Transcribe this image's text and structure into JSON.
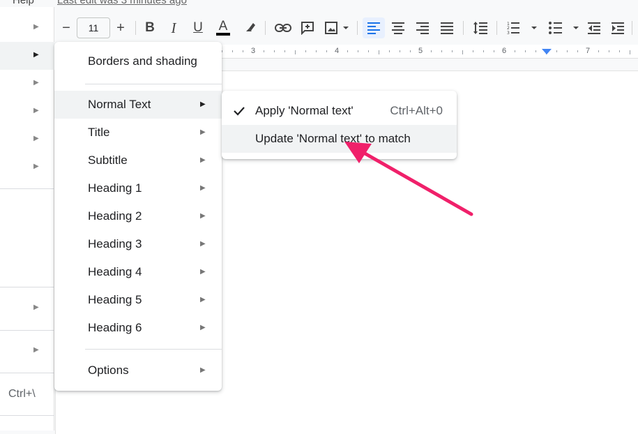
{
  "header": {
    "help_menu": "Help",
    "last_edit": "Last edit was 3 minutes ago"
  },
  "toolbar": {
    "font_size": "11",
    "decrease_size": "−",
    "increase_size": "+",
    "bold": "B",
    "italic": "I",
    "underline": "U",
    "text_color": "A",
    "icons": [
      "minus-icon",
      "plus-icon",
      "bold-icon",
      "italic-icon",
      "underline-icon",
      "text-color-icon",
      "highlight-icon",
      "link-icon",
      "add-comment-icon",
      "insert-image-icon",
      "align-left-icon",
      "align-center-icon",
      "align-right-icon",
      "justify-icon",
      "line-spacing-icon",
      "numbered-list-icon",
      "bulleted-list-icon",
      "decrease-indent-icon",
      "increase-indent-icon"
    ],
    "active_alignment": "align-left"
  },
  "ruler": {
    "numbers": [
      "3",
      "4",
      "5",
      "6",
      "7"
    ]
  },
  "background_menu": {
    "shortcut": "Ctrl+\\"
  },
  "paragraph_styles_menu": {
    "borders_and_shading": "Borders and shading",
    "items": [
      {
        "label": "Normal Text",
        "highlighted": true
      },
      {
        "label": "Title"
      },
      {
        "label": "Subtitle"
      },
      {
        "label": "Heading 1"
      },
      {
        "label": "Heading 2"
      },
      {
        "label": "Heading 3"
      },
      {
        "label": "Heading 4"
      },
      {
        "label": "Heading 5"
      },
      {
        "label": "Heading 6"
      }
    ],
    "options": "Options"
  },
  "submenu": {
    "apply_label": "Apply 'Normal text'",
    "apply_shortcut": "Ctrl+Alt+0",
    "update_label": "Update 'Normal text' to match"
  },
  "colors": {
    "accent": "#1a73e8",
    "annotation_arrow": "#f0206a",
    "highlight": "#f1f3f4"
  }
}
